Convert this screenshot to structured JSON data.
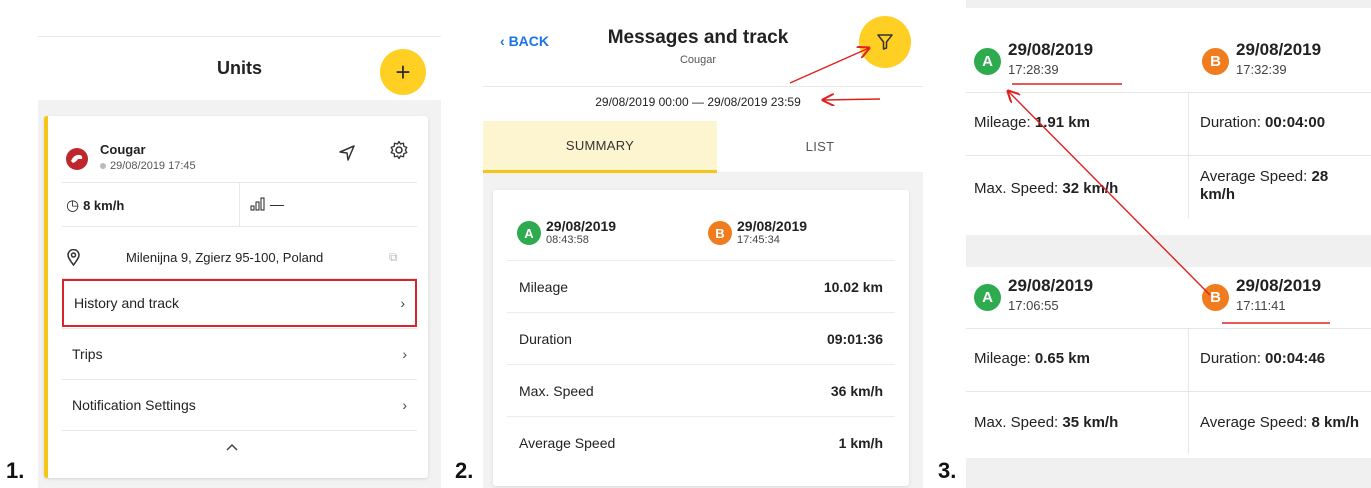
{
  "labels": [
    "1.",
    "2.",
    "3."
  ],
  "colors": {
    "accent_yellow": "#ffcf24",
    "highlight_red": "#d8242b",
    "point_a_green": "#2eaa4f",
    "point_b_orange": "#f07c1e",
    "link_blue": "#1a73e8"
  },
  "panel1": {
    "title": "Units",
    "add_icon": "plus-icon",
    "unit": {
      "name": "Cougar",
      "last_update": "29/08/2019 17:45"
    },
    "speed": "8 km/h",
    "signal": "—",
    "address": "Milenijna 9, Zgierz 95-100, Poland",
    "menu": [
      {
        "label": "History and track",
        "highlighted": true
      },
      {
        "label": "Trips"
      },
      {
        "label": "Notification Settings"
      }
    ]
  },
  "panel2": {
    "back_label": "BACK",
    "title": "Messages and track",
    "subtitle": "Cougar",
    "date_range": "29/08/2019 00:00 — 29/08/2019 23:59",
    "tabs": [
      "SUMMARY",
      "LIST"
    ],
    "active_tab": "SUMMARY",
    "point_a": {
      "badge": "A",
      "date": "29/08/2019",
      "time": "08:43:58"
    },
    "point_b": {
      "badge": "B",
      "date": "29/08/2019",
      "time": "17:45:34"
    },
    "rows": [
      {
        "label": "Mileage",
        "value": "10.02 km"
      },
      {
        "label": "Duration",
        "value": "09:01:36"
      },
      {
        "label": "Max. Speed",
        "value": "36 km/h"
      },
      {
        "label": "Average Speed",
        "value": "1 km/h"
      }
    ]
  },
  "panel3": {
    "trips": [
      {
        "point_a": {
          "badge": "A",
          "date": "29/08/2019",
          "time": "17:28:39"
        },
        "point_b": {
          "badge": "B",
          "date": "29/08/2019",
          "time": "17:32:39"
        },
        "mileage_label": "Mileage:",
        "mileage": "1.91 km",
        "duration_label": "Duration:",
        "duration": "00:04:00",
        "max_speed_label": "Max. Speed:",
        "max_speed": "32 km/h",
        "avg_speed_label": "Average Speed:",
        "avg_speed_a": "28",
        "avg_speed_b": "km/h"
      },
      {
        "point_a": {
          "badge": "A",
          "date": "29/08/2019",
          "time": "17:06:55"
        },
        "point_b": {
          "badge": "B",
          "date": "29/08/2019",
          "time": "17:11:41"
        },
        "mileage_label": "Mileage:",
        "mileage": "0.65 km",
        "duration_label": "Duration:",
        "duration": "00:04:46",
        "max_speed_label": "Max. Speed:",
        "max_speed": "35 km/h",
        "avg_speed_label": "Average Speed:",
        "avg_speed": "8 km/h"
      }
    ]
  }
}
